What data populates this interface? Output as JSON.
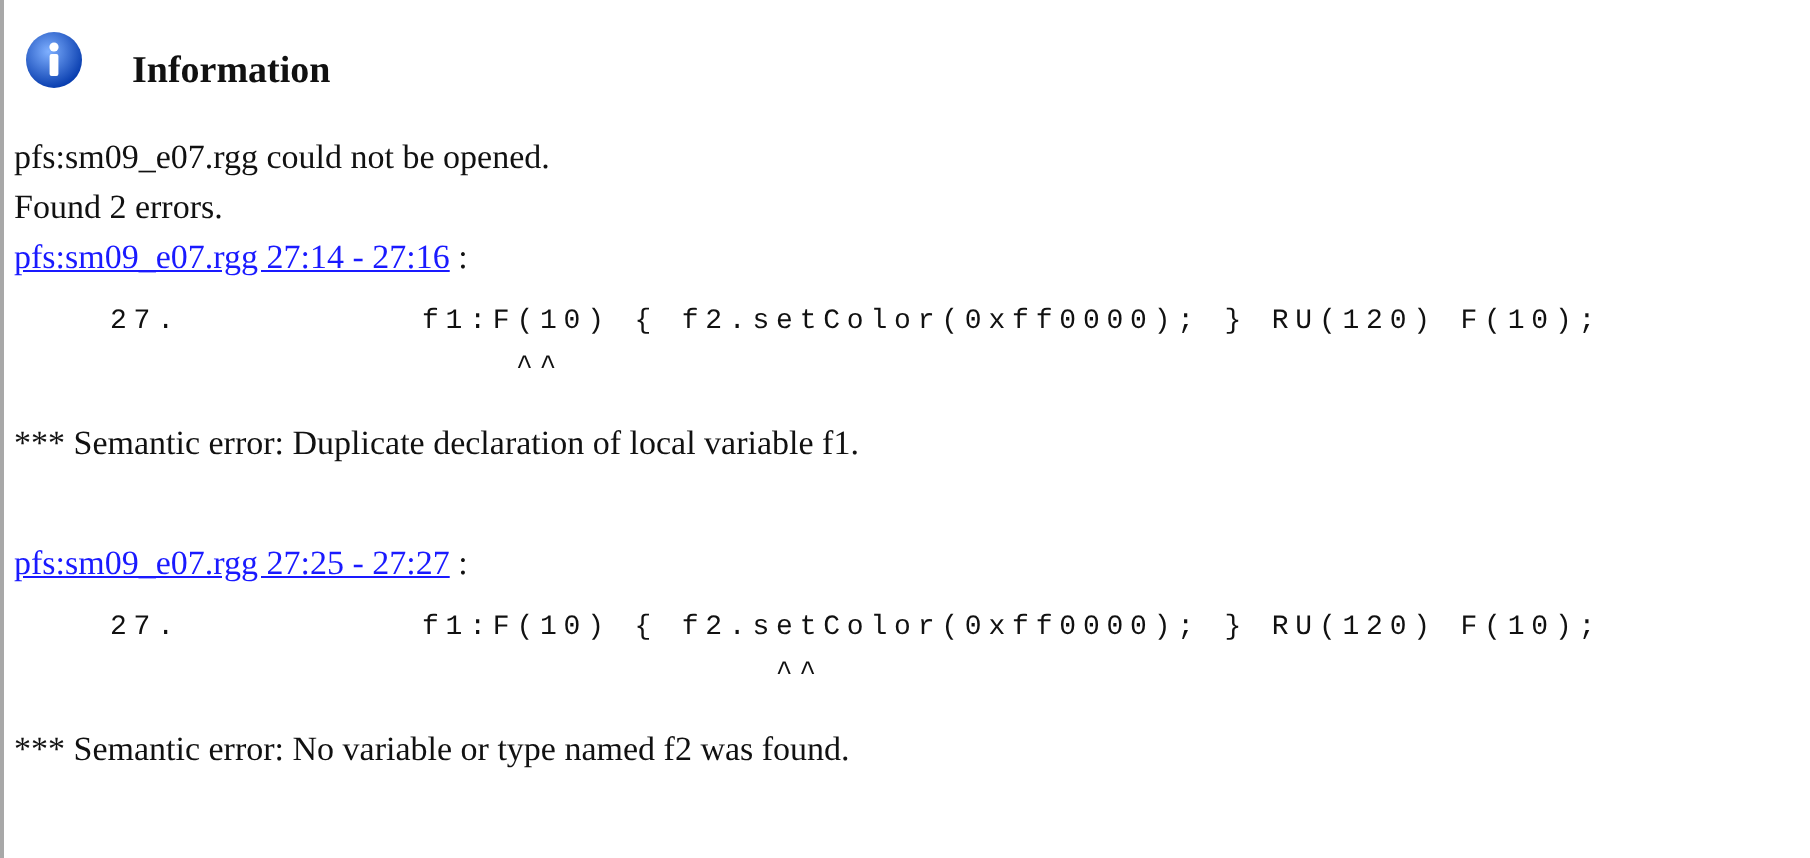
{
  "title": "Information",
  "messages": [
    "pfs:sm09_e07.rgg could not be opened.",
    "Found 2 errors."
  ],
  "errors": [
    {
      "link": "pfs:sm09_e07.rgg 27:14 - 27:16",
      "separator": ":",
      "line_number": "27.",
      "code": "f1:F(10) { f2.setColor(0xff0000); } RU(120) F(10);",
      "caret": "^^",
      "message": "*** Semantic error: Duplicate declaration of local variable f1."
    },
    {
      "link": "pfs:sm09_e07.rgg 27:25 - 27:27",
      "separator": ":",
      "line_number": "27.",
      "code": "f1:F(10) { f2.setColor(0xff0000); } RU(120) F(10);",
      "caret": "           ^^",
      "message": "*** Semantic error: No variable or type named f2 was found."
    }
  ]
}
